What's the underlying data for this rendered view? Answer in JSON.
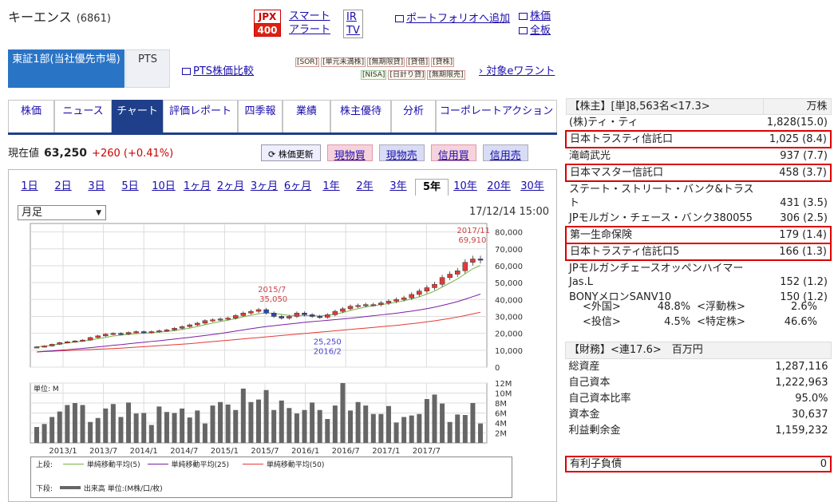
{
  "header": {
    "company": "キーエンス",
    "code": "(6861)",
    "jpx_top": "JPX",
    "jpx_bottom": "400",
    "smart_alert_1": "スマート",
    "smart_alert_2": "アラート",
    "ir_1": "IR",
    "ir_2": "TV",
    "portfolio": "ポートフォリオへ追加",
    "link_stock": "株価",
    "link_board": "全板"
  },
  "market": {
    "selected": "東証1部(当社優先市場)",
    "pts": "PTS",
    "pts_compare": "PTS株価比較",
    "tags_row1": [
      "SOR",
      "単元未満株",
      "無期限貸",
      "貸借",
      "貸株"
    ],
    "tags_row2": [
      "NISA",
      "日計り貸",
      "無期限売"
    ],
    "warrant": "対象eワラント"
  },
  "tabs": [
    "株価",
    "ニュース",
    "チャート",
    "評価レポート",
    "四季報",
    "業績",
    "株主優待",
    "分析",
    "コーポレートアクション"
  ],
  "price": {
    "label": "現在値",
    "value": "63,250",
    "change": "+260 (+0.41%)"
  },
  "buttons": {
    "update": "株価更新",
    "genbutsu_buy": "現物買",
    "genbutsu_sell": "現物売",
    "shinyo_buy": "信用買",
    "shinyo_sell": "信用売"
  },
  "periods": [
    "1日",
    "2日",
    "3日",
    "5日",
    "10日",
    "1ヶ月",
    "2ヶ月",
    "3ヶ月",
    "6ヶ月",
    "1年",
    "2年",
    "3年",
    "5年",
    "10年",
    "20年",
    "30年"
  ],
  "chart_controls": {
    "interval": "月足",
    "datetime": "17/12/14 15:00"
  },
  "chart_data": [
    {
      "type": "candlestick",
      "x": [
        "2013/1",
        "2013/7",
        "2014/1",
        "2014/7",
        "2015/1",
        "2015/7",
        "2016/1",
        "2016/7",
        "2017/1",
        "2017/7"
      ],
      "ytick_labels": [
        "80,000",
        "70,000",
        "60,000",
        "50,000",
        "40,000",
        "30,000",
        "20,000",
        "10,000",
        "0"
      ],
      "ylim": [
        0,
        85000
      ],
      "price_series": [
        12000,
        12500,
        13500,
        14500,
        15000,
        15500,
        16000,
        17500,
        18500,
        19500,
        20000,
        19500,
        20500,
        21000,
        20500,
        21000,
        21500,
        22000,
        23000,
        24000,
        25000,
        26000,
        27500,
        28000,
        28500,
        29000,
        30500,
        32000,
        33000,
        34000,
        32000,
        30000,
        29000,
        30000,
        32000,
        31000,
        30000,
        29500,
        31000,
        33000,
        34500,
        36000,
        36500,
        37000,
        37000,
        38000,
        39000,
        40000,
        41000,
        43000,
        45000,
        47000,
        49000,
        53000,
        55000,
        57000,
        62000,
        64000,
        63250
      ],
      "ma5": [
        12000,
        12400,
        13000,
        13700,
        14300,
        14800,
        15300,
        16100,
        16800,
        17600,
        18400,
        18900,
        19400,
        19800,
        20000,
        20400,
        20800,
        21100,
        21600,
        22300,
        23100,
        24000,
        25100,
        26100,
        27000,
        27800,
        28700,
        29800,
        30700,
        31600,
        32100,
        31800,
        31200,
        30600,
        30600,
        30600,
        30400,
        30300,
        30700,
        31300,
        32300,
        33500,
        34600,
        35600,
        36300,
        37000,
        37600,
        38400,
        39300,
        40300,
        41600,
        43200,
        45000,
        47400,
        49800,
        52200,
        55200,
        58200,
        60200
      ],
      "ma25": [
        9000,
        9300,
        9600,
        10000,
        10300,
        10700,
        11100,
        11500,
        12000,
        12400,
        12900,
        13300,
        13800,
        14300,
        14700,
        15200,
        15600,
        16100,
        16600,
        17100,
        17600,
        18200,
        18700,
        19300,
        19900,
        20600,
        21300,
        22000,
        22700,
        23400,
        24000,
        24500,
        25000,
        25500,
        26000,
        26500,
        26900,
        27300,
        27700,
        28100,
        28500,
        28900,
        29400,
        29900,
        30400,
        30900,
        31400,
        31900,
        32500,
        33100,
        33800,
        34600,
        35500,
        36500,
        37600,
        38800,
        40200,
        41700,
        43200
      ],
      "ma50": [
        9000,
        9200,
        9400,
        9600,
        9800,
        10000,
        10200,
        10400,
        10600,
        10800,
        11000,
        11200,
        11500,
        11800,
        12100,
        12400,
        12700,
        13000,
        13300,
        13600,
        13900,
        14300,
        14700,
        15100,
        15500,
        15900,
        16300,
        16700,
        17100,
        17500,
        17900,
        18300,
        18700,
        19100,
        19500,
        19900,
        20300,
        20700,
        21100,
        21500,
        21900,
        22300,
        22700,
        23100,
        23500,
        23900,
        24300,
        24700,
        25200,
        25700,
        26200,
        26800,
        27400,
        28100,
        28800,
        29600,
        30500,
        31500,
        32500
      ],
      "annotations": [
        {
          "text1": "2017/11",
          "text2": "69,910",
          "kind": "high",
          "index": 57,
          "value": 69910
        },
        {
          "text1": "2015/7",
          "text2": "35,050",
          "kind": "high",
          "index": 31,
          "value": 35050
        },
        {
          "text1": "25,250",
          "text2": "2016/2",
          "kind": "low",
          "index": 37,
          "value": 25250
        }
      ]
    },
    {
      "type": "bar",
      "ylabel": "単位: M",
      "ytick_labels": [
        "12M",
        "10M",
        "8M",
        "6M",
        "4M",
        "2M"
      ],
      "ylim": [
        0,
        12
      ],
      "values": [
        3.2,
        3.8,
        5.2,
        6.3,
        7.6,
        8.0,
        7.6,
        4.2,
        5.0,
        6.9,
        7.8,
        5.2,
        8.1,
        5.9,
        6.0,
        3.6,
        7.3,
        6.2,
        6.0,
        6.9,
        5.1,
        6.5,
        3.9,
        7.5,
        8.2,
        7.7,
        6.6,
        10.9,
        8.2,
        8.7,
        10.6,
        6.6,
        8.5,
        7.0,
        5.9,
        6.6,
        8.1,
        6.6,
        4.8,
        7.5,
        12.0,
        6.5,
        8.2,
        7.5,
        5.8,
        5.8,
        7.4,
        4.1,
        5.2,
        5.5,
        5.8,
        8.8,
        9.7,
        7.9,
        4.2,
        5.7,
        5.6,
        8.0,
        3.9
      ]
    }
  ],
  "chart_legend": {
    "upper_label": "上段:",
    "ma5": "単純移動平均(5)",
    "ma25": "単純移動平均(25)",
    "ma50": "単純移動平均(50)",
    "lower_label": "下段:",
    "volume": "出来高 単位:(M株/口/枚)",
    "colors": {
      "ma5": "#7cb342",
      "ma25": "#7b1fa2",
      "ma50": "#e53935",
      "volume": "#666666",
      "candle_up": "#e53935",
      "candle_down": "#2a48b8"
    }
  },
  "shareholders": {
    "title": "【株主】",
    "summary": "[単]8,563名<17.3>",
    "unit": "万株",
    "rows": [
      {
        "name": "(株)ティ・ティ",
        "value": "1,828(15.0)",
        "hl": false
      },
      {
        "name": "日本トラスティ信託口",
        "value": "1,025 (8.4)",
        "hl": true
      },
      {
        "name": "滝崎武光",
        "value": "937 (7.7)",
        "hl": false
      },
      {
        "name": "日本マスター信託口",
        "value": "458 (3.7)",
        "hl": true
      },
      {
        "name": "ステート・ストリート・バンク&トラスト",
        "value": "431 (3.5)",
        "hl": false
      },
      {
        "name": "JPモルガン・チェース・バンク380055",
        "value": "306 (2.5)",
        "hl": false
      },
      {
        "name": "第一生命保険",
        "value": "179 (1.4)",
        "hl": true
      },
      {
        "name": "日本トラスティ信託口5",
        "value": "166 (1.3)",
        "hl": true
      },
      {
        "name": "JPモルガンチェースオッペンハイマーJas.L",
        "value": "152 (1.2)",
        "hl": false
      },
      {
        "name": "BONYメロンSANV10",
        "value": "150 (1.2)",
        "hl": false
      }
    ],
    "foreign_label": "<外国>",
    "foreign_value": "48.8%",
    "float_label": "<浮動株>",
    "float_value": "2.6%",
    "invest_label": "<投信>",
    "invest_value": "4.5%",
    "specific_label": "<特定株>",
    "specific_value": "46.6%"
  },
  "finance": {
    "title": "【財務】",
    "period": "<連17.6>",
    "unit": "百万円",
    "rows": [
      {
        "name": "総資産",
        "value": "1,287,116"
      },
      {
        "name": "自己資本",
        "value": "1,222,963"
      },
      {
        "name": "自己資本比率",
        "value": "95.0%"
      },
      {
        "name": "資本金",
        "value": "30,637"
      },
      {
        "name": "利益剰余金",
        "value": "1,159,232"
      }
    ],
    "debt_label": "有利子負債",
    "debt_value": "0"
  }
}
